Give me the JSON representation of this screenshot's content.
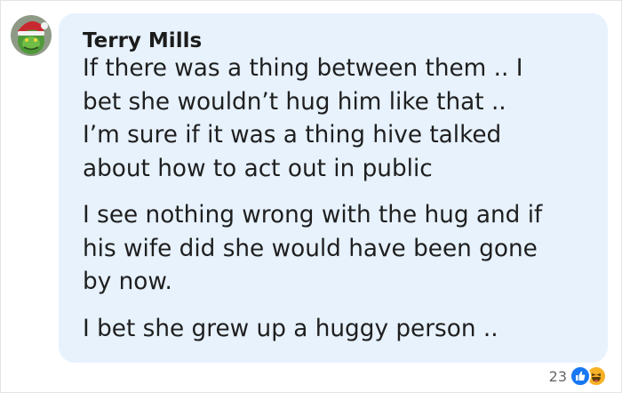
{
  "comment": {
    "author": "Terry Mills",
    "avatar_icon": "grinch-avatar-icon",
    "paragraphs": [
      [
        "If there was a thing between them .. I",
        "bet she wouldn’t hug him like that ..",
        "I’m sure if it was a thing hive talked",
        "about how to act out in public"
      ],
      [
        "I see nothing wrong with the hug and if",
        "his wife did she would have been gone",
        "by now."
      ],
      [
        "I bet she grew up a huggy person .."
      ]
    ],
    "bubble_color": "#e7f2fd"
  },
  "reactions": {
    "count": "23",
    "icons": [
      "like-icon",
      "haha-icon"
    ],
    "colors": {
      "like": "#1877f2",
      "haha": "#f7b125"
    }
  }
}
